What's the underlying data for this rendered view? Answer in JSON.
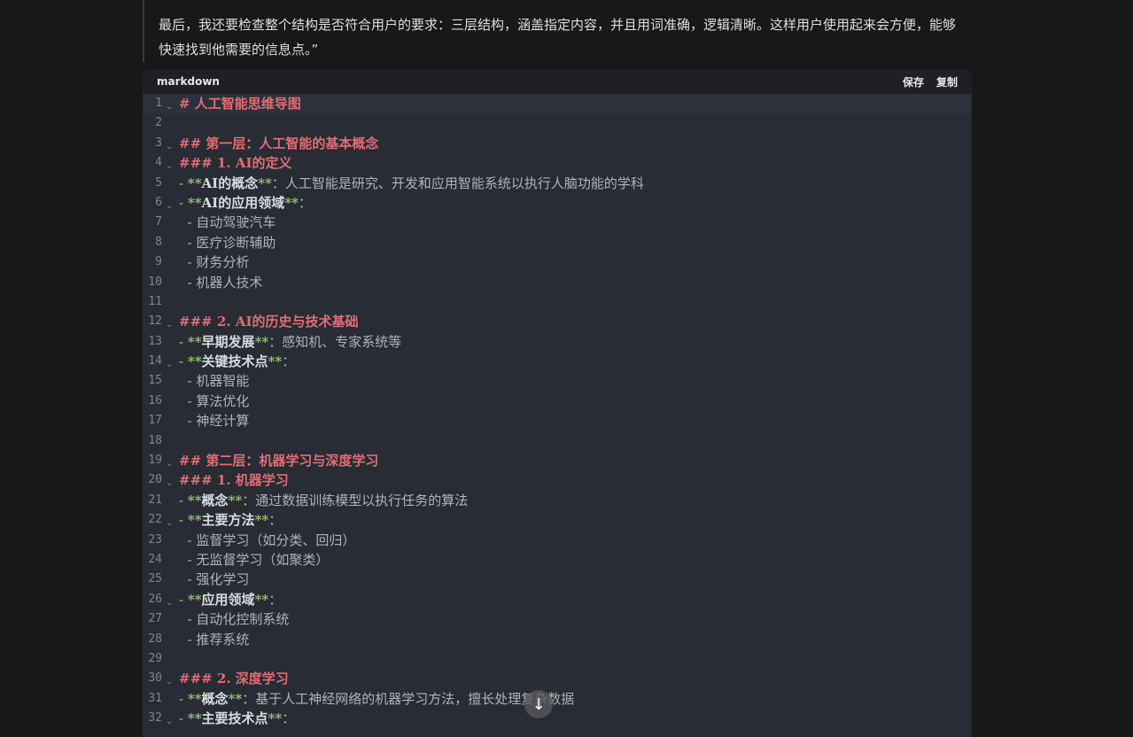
{
  "thinking": {
    "text": "最后，我还要检查整个结构是否符合用户的要求：三层结构，涵盖指定内容，并且用词准确，逻辑清晰。这样用户使用起来会方便，能够快速找到他需要的信息点。”"
  },
  "code_block": {
    "language": "markdown",
    "save_label": "保存",
    "copy_label": "复制",
    "lines": [
      {
        "n": "1",
        "fold": true,
        "kind": "heading",
        "text": "# 人工智能思维导图"
      },
      {
        "n": "2",
        "fold": false,
        "kind": "blank",
        "text": ""
      },
      {
        "n": "3",
        "fold": true,
        "kind": "heading",
        "text": "## 第一层：人工智能的基本概念"
      },
      {
        "n": "4",
        "fold": true,
        "kind": "heading",
        "text": "### 1. AI的定义"
      },
      {
        "n": "5",
        "fold": false,
        "kind": "item",
        "bold": "AI的概念",
        "rest": "：人工智能是研究、开发和应用智能系统以执行人脑功能的学科"
      },
      {
        "n": "6",
        "fold": true,
        "kind": "item",
        "bold": "AI的应用领域",
        "rest": "："
      },
      {
        "n": "7",
        "fold": false,
        "kind": "sub",
        "text": "自动驾驶汽车"
      },
      {
        "n": "8",
        "fold": false,
        "kind": "sub",
        "text": "医疗诊断辅助"
      },
      {
        "n": "9",
        "fold": false,
        "kind": "sub",
        "text": "财务分析"
      },
      {
        "n": "10",
        "fold": false,
        "kind": "sub",
        "text": "机器人技术"
      },
      {
        "n": "11",
        "fold": false,
        "kind": "blank",
        "text": ""
      },
      {
        "n": "12",
        "fold": true,
        "kind": "heading",
        "text": "### 2. AI的历史与技术基础"
      },
      {
        "n": "13",
        "fold": false,
        "kind": "item",
        "bold": "早期发展",
        "rest": "：感知机、专家系统等"
      },
      {
        "n": "14",
        "fold": true,
        "kind": "item",
        "bold": "关键技术点",
        "rest": "："
      },
      {
        "n": "15",
        "fold": false,
        "kind": "sub",
        "text": "机器智能"
      },
      {
        "n": "16",
        "fold": false,
        "kind": "sub",
        "text": "算法优化"
      },
      {
        "n": "17",
        "fold": false,
        "kind": "sub",
        "text": "神经计算"
      },
      {
        "n": "18",
        "fold": false,
        "kind": "blank",
        "text": ""
      },
      {
        "n": "19",
        "fold": true,
        "kind": "heading",
        "text": "## 第二层：机器学习与深度学习"
      },
      {
        "n": "20",
        "fold": true,
        "kind": "heading",
        "text": "### 1. 机器学习"
      },
      {
        "n": "21",
        "fold": false,
        "kind": "item",
        "bold": "概念",
        "rest": "：通过数据训练模型以执行任务的算法"
      },
      {
        "n": "22",
        "fold": true,
        "kind": "item",
        "bold": "主要方法",
        "rest": "："
      },
      {
        "n": "23",
        "fold": false,
        "kind": "sub",
        "text": "监督学习（如分类、回归）"
      },
      {
        "n": "24",
        "fold": false,
        "kind": "sub",
        "text": "无监督学习（如聚类）"
      },
      {
        "n": "25",
        "fold": false,
        "kind": "sub",
        "text": "强化学习"
      },
      {
        "n": "26",
        "fold": true,
        "kind": "item",
        "bold": "应用领域",
        "rest": "："
      },
      {
        "n": "27",
        "fold": false,
        "kind": "sub",
        "text": "自动化控制系统"
      },
      {
        "n": "28",
        "fold": false,
        "kind": "sub",
        "text": "推荐系统"
      },
      {
        "n": "29",
        "fold": false,
        "kind": "blank",
        "text": ""
      },
      {
        "n": "30",
        "fold": true,
        "kind": "heading",
        "text": "### 2. 深度学习"
      },
      {
        "n": "31",
        "fold": false,
        "kind": "item",
        "bold": "概念",
        "rest": "：基于人工神经网络的机器学习方法，擅长处理复杂数据"
      },
      {
        "n": "32",
        "fold": true,
        "kind": "item",
        "bold": "主要技术点",
        "rest": "："
      }
    ]
  },
  "scroll_button": {
    "icon": "arrow-down-icon",
    "glyph": "↓"
  }
}
